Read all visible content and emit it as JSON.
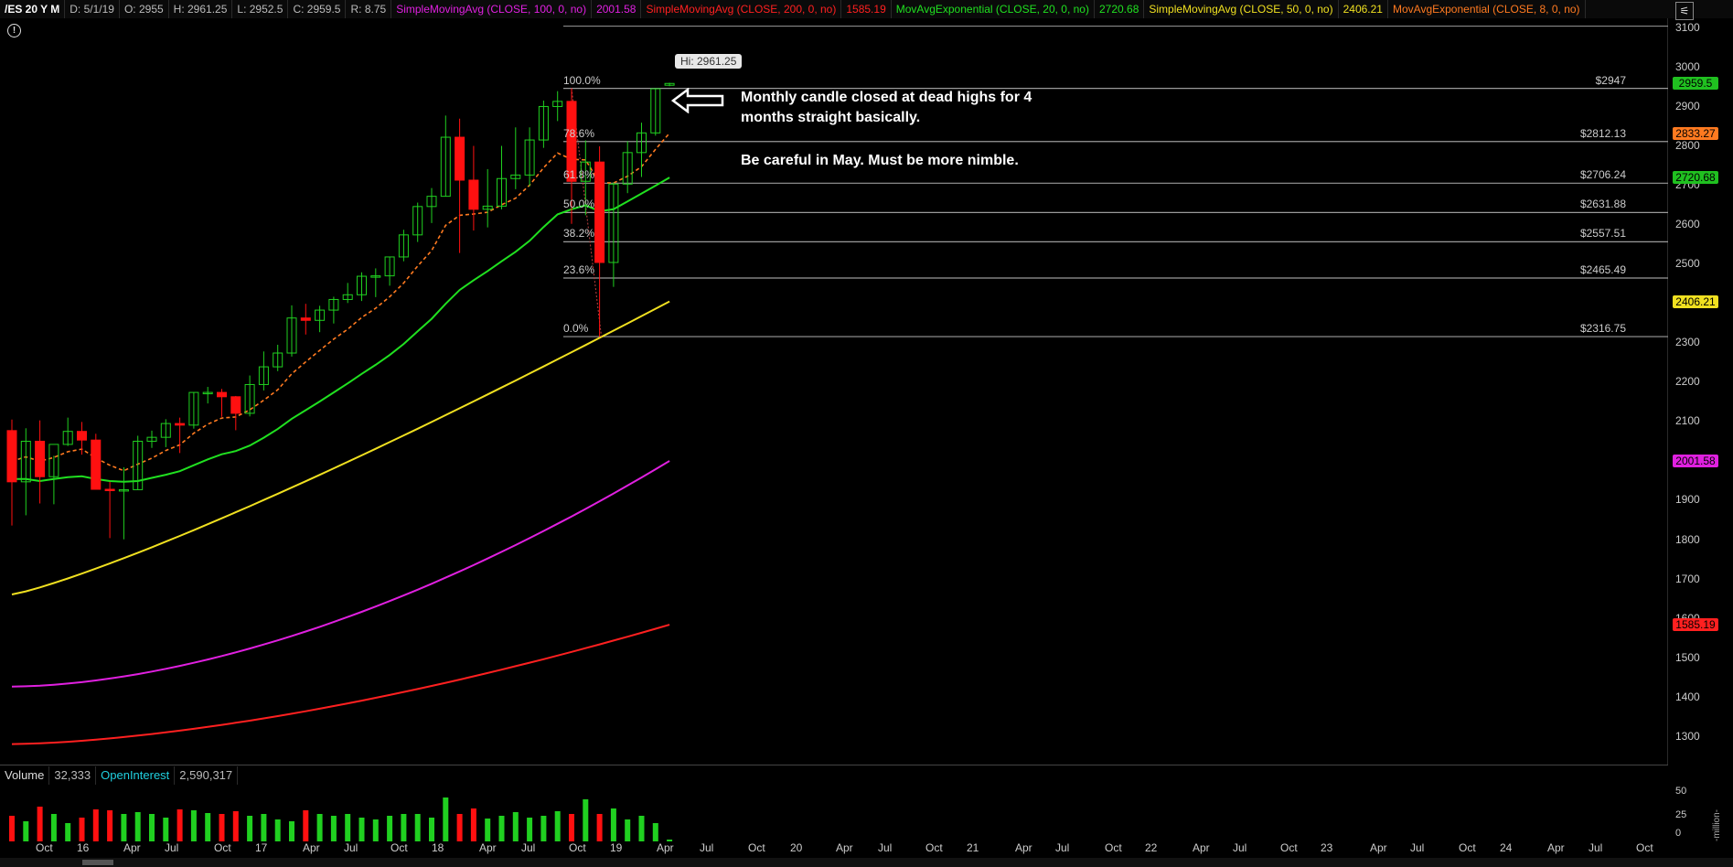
{
  "header": {
    "symbol": "/ES 20 Y M",
    "date": "D: 5/1/19",
    "open": "O: 2955",
    "high": "H: 2961.25",
    "low": "L: 2952.5",
    "close": "C: 2959.5",
    "range": "R: 8.75",
    "studies": [
      {
        "label": "SimpleMovingAvg (CLOSE, 100, 0, no)",
        "value": "2001.58",
        "color": "#e020e0"
      },
      {
        "label": "SimpleMovingAvg (CLOSE, 200, 0, no)",
        "value": "1585.19",
        "color": "#ff2020"
      },
      {
        "label": "MovAvgExponential (CLOSE, 20, 0, no)",
        "value": "2720.68",
        "color": "#20e020"
      },
      {
        "label": "SimpleMovingAvg (CLOSE, 50, 0, no)",
        "value": "2406.21",
        "color": "#f0e020"
      },
      {
        "label": "MovAvgExponential (CLOSE, 8, 0, no)",
        "value": "",
        "color": "#ff7a20"
      }
    ]
  },
  "price_axis": [
    "3100",
    "3000",
    "2900",
    "2800",
    "2700",
    "2600",
    "2500",
    "2400",
    "2300",
    "2200",
    "2100",
    "2000",
    "1900",
    "1800",
    "1700",
    "1600",
    "1500",
    "1400",
    "1300"
  ],
  "value_tags": {
    "last": {
      "text": "2959.5",
      "bg": "#20c020",
      "fg": "#000"
    },
    "ema8": {
      "text": "2833.27",
      "bg": "#ff7a20",
      "fg": "#000"
    },
    "ema20": {
      "text": "2720.68",
      "bg": "#20c020",
      "fg": "#000"
    },
    "sma50": {
      "text": "2406.21",
      "bg": "#f0e020",
      "fg": "#000"
    },
    "sma100": {
      "text": "2001.58",
      "bg": "#e020e0",
      "fg": "#000"
    },
    "sma200": {
      "text": "1585.19",
      "bg": "#ff2020",
      "fg": "#000"
    }
  },
  "fibonacci": [
    {
      "label": "100.0%",
      "price": "$2947"
    },
    {
      "label": "78.6%",
      "price": "$2812.13"
    },
    {
      "label": "61.8%",
      "price": "$2706.24"
    },
    {
      "label": "50.0%",
      "price": "$2631.88"
    },
    {
      "label": "38.2%",
      "price": "$2557.51"
    },
    {
      "label": "23.6%",
      "price": "$2465.49"
    },
    {
      "label": "0.0%",
      "price": "$2316.75"
    }
  ],
  "hi_bubble": "Hi: 2961.25",
  "annotation": {
    "line1": "Monthly candle closed at dead highs for 4",
    "line2": "months straight basically.",
    "line3": "Be careful in May. Must be more nimble."
  },
  "volume_panel": {
    "volume_label": "Volume",
    "volume_value": "32,333",
    "oi_label": "OpenInterest",
    "oi_value": "2,590,317",
    "scale": [
      "50",
      "25",
      "0"
    ],
    "unit": "-million-"
  },
  "time_axis": [
    "Oct",
    "16",
    "Apr",
    "Jul",
    "Oct",
    "17",
    "Apr",
    "Jul",
    "Oct",
    "18",
    "Apr",
    "Jul",
    "Oct",
    "19",
    "Apr",
    "Jul",
    "Oct",
    "20",
    "Apr",
    "Jul",
    "Oct",
    "21",
    "Apr",
    "Jul",
    "Oct",
    "22",
    "Apr",
    "Jul",
    "Oct",
    "23",
    "Apr",
    "Jul",
    "Oct",
    "24",
    "Apr",
    "Jul",
    "Oct"
  ],
  "chart_data": {
    "type": "candlestick",
    "candles": [
      {
        "o": 2078,
        "h": 2106,
        "l": 1837,
        "c": 1948
      },
      {
        "o": 1948,
        "h": 2084,
        "l": 1863,
        "c": 2051
      },
      {
        "o": 2051,
        "h": 2104,
        "l": 1893,
        "c": 1961
      },
      {
        "o": 1961,
        "h": 2014,
        "l": 1891,
        "c": 2043
      },
      {
        "o": 2043,
        "h": 2111,
        "l": 2039,
        "c": 2076
      },
      {
        "o": 2076,
        "h": 2100,
        "l": 2017,
        "c": 2054
      },
      {
        "o": 2054,
        "h": 2070,
        "l": 1991,
        "c": 1929
      },
      {
        "o": 1929,
        "h": 1948,
        "l": 1805,
        "c": 1926
      },
      {
        "o": 1926,
        "h": 1985,
        "l": 1802,
        "c": 1928
      },
      {
        "o": 1928,
        "h": 2065,
        "l": 1927,
        "c": 2051
      },
      {
        "o": 2051,
        "h": 2078,
        "l": 2034,
        "c": 2061
      },
      {
        "o": 2061,
        "h": 2107,
        "l": 2036,
        "c": 2096
      },
      {
        "o": 2096,
        "h": 2111,
        "l": 2021,
        "c": 2092
      },
      {
        "o": 2092,
        "h": 2174,
        "l": 2083,
        "c": 2175
      },
      {
        "o": 2175,
        "h": 2189,
        "l": 2147,
        "c": 2175
      },
      {
        "o": 2175,
        "h": 2184,
        "l": 2113,
        "c": 2164
      },
      {
        "o": 2164,
        "h": 2166,
        "l": 2079,
        "c": 2122
      },
      {
        "o": 2122,
        "h": 2218,
        "l": 2114,
        "c": 2195
      },
      {
        "o": 2195,
        "h": 2279,
        "l": 2180,
        "c": 2240
      },
      {
        "o": 2240,
        "h": 2296,
        "l": 2229,
        "c": 2275
      },
      {
        "o": 2275,
        "h": 2396,
        "l": 2266,
        "c": 2364
      },
      {
        "o": 2364,
        "h": 2400,
        "l": 2322,
        "c": 2358
      },
      {
        "o": 2358,
        "h": 2395,
        "l": 2328,
        "c": 2384
      },
      {
        "o": 2384,
        "h": 2418,
        "l": 2350,
        "c": 2411
      },
      {
        "o": 2411,
        "h": 2453,
        "l": 2402,
        "c": 2423
      },
      {
        "o": 2423,
        "h": 2480,
        "l": 2407,
        "c": 2470
      },
      {
        "o": 2470,
        "h": 2490,
        "l": 2417,
        "c": 2471
      },
      {
        "o": 2471,
        "h": 2519,
        "l": 2446,
        "c": 2519
      },
      {
        "o": 2519,
        "h": 2588,
        "l": 2508,
        "c": 2575
      },
      {
        "o": 2575,
        "h": 2657,
        "l": 2557,
        "c": 2647
      },
      {
        "o": 2647,
        "h": 2694,
        "l": 2605,
        "c": 2673
      },
      {
        "o": 2673,
        "h": 2878,
        "l": 2673,
        "c": 2823
      },
      {
        "o": 2823,
        "h": 2870,
        "l": 2529,
        "c": 2714
      },
      {
        "o": 2714,
        "h": 2801,
        "l": 2586,
        "c": 2640
      },
      {
        "o": 2640,
        "h": 2742,
        "l": 2594,
        "c": 2648
      },
      {
        "o": 2648,
        "h": 2801,
        "l": 2640,
        "c": 2718
      },
      {
        "o": 2718,
        "h": 2848,
        "l": 2691,
        "c": 2727
      },
      {
        "o": 2727,
        "h": 2848,
        "l": 2698,
        "c": 2816
      },
      {
        "o": 2816,
        "h": 2916,
        "l": 2796,
        "c": 2901
      },
      {
        "o": 2901,
        "h": 2940,
        "l": 2864,
        "c": 2914
      },
      {
        "o": 2914,
        "h": 2947,
        "l": 2603,
        "c": 2711
      },
      {
        "o": 2711,
        "h": 2815,
        "l": 2625,
        "c": 2760
      },
      {
        "o": 2760,
        "h": 2800,
        "l": 2316,
        "c": 2505
      },
      {
        "o": 2505,
        "h": 2708,
        "l": 2443,
        "c": 2704
      },
      {
        "o": 2704,
        "h": 2813,
        "l": 2681,
        "c": 2784
      },
      {
        "o": 2784,
        "h": 2860,
        "l": 2722,
        "c": 2834
      },
      {
        "o": 2834,
        "h": 2947,
        "l": 2827,
        "c": 2946
      },
      {
        "o": 2955,
        "h": 2961.25,
        "l": 2952.5,
        "c": 2959.5
      }
    ],
    "volume": [
      28,
      22,
      38,
      30,
      20,
      26,
      35,
      34,
      30,
      32,
      30,
      26,
      35,
      34,
      31,
      30,
      33,
      28,
      30,
      24,
      22,
      34,
      30,
      28,
      30,
      26,
      24,
      28,
      30,
      30,
      26,
      48,
      30,
      36,
      25,
      28,
      32,
      26,
      28,
      33,
      30,
      46,
      30,
      36,
      24,
      28,
      20,
      2
    ],
    "ylim": [
      1230,
      3125
    ],
    "xlabel": "",
    "ylabel": ""
  }
}
